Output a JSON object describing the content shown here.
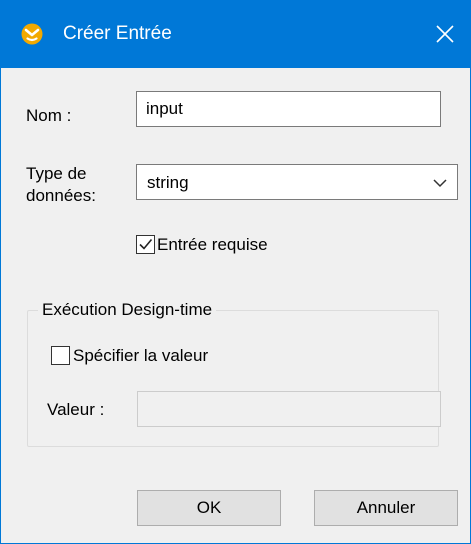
{
  "window": {
    "title": "Créer Entrée",
    "app_icon": "altova-mapforce-icon",
    "close_icon": "close-icon"
  },
  "form": {
    "name_label": "Nom :",
    "name_value": "input",
    "datatype_label_line1": "Type de",
    "datatype_label_line2": "données:",
    "datatype_value": "string",
    "required_label": "Entrée requise",
    "required_checked": true
  },
  "design_time": {
    "group_title": "Exécution Design-time",
    "specify_label": "Spécifier la valeur",
    "specify_checked": false,
    "value_label": "Valeur :",
    "value": ""
  },
  "buttons": {
    "ok_label": "OK",
    "cancel_label": "Annuler"
  },
  "colors": {
    "titlebar": "#0078d7",
    "accent_icon": "#f2a900",
    "dialog_bg": "#f0f0f0"
  }
}
